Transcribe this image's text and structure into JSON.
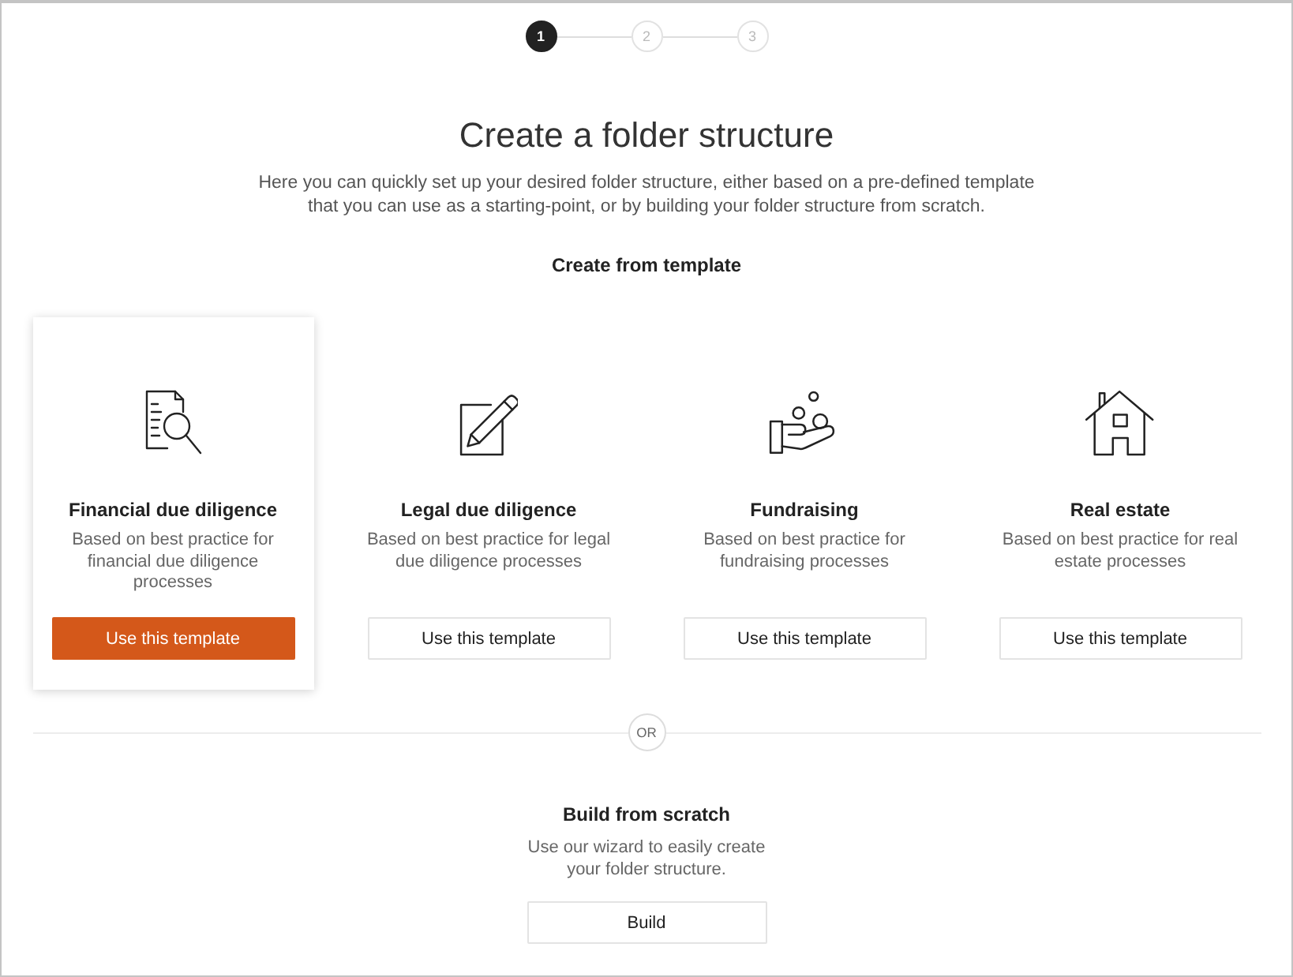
{
  "steps": [
    {
      "label": "1",
      "selected": true
    },
    {
      "label": "2",
      "selected": false
    },
    {
      "label": "3",
      "selected": false
    }
  ],
  "header": {
    "title": "Create a folder structure",
    "intro": "Here you can quickly set up your desired folder structure, either based on a pre-defined template that you can use as a starting-point, or by building your folder structure from scratch."
  },
  "templates_section": {
    "heading": "Create from template",
    "templates": [
      {
        "title": "Financial due diligence",
        "description": "Based on best practice for financial due diligence processes",
        "button": "Use this template",
        "selected": true
      },
      {
        "title": "Legal due diligence",
        "description": "Based on best practice for legal due diligence processes",
        "button": "Use this template",
        "selected": false
      },
      {
        "title": "Fundraising",
        "description": "Based on best practice for fundraising processes",
        "button": "Use this template",
        "selected": false
      },
      {
        "title": "Real estate",
        "description": "Based on best practice for real estate processes",
        "button": "Use this template",
        "selected": false
      }
    ]
  },
  "separator": {
    "label": "OR"
  },
  "scratch": {
    "title": "Build from scratch",
    "description": "Use our wizard to easily create your folder structure.",
    "button": "Build"
  }
}
